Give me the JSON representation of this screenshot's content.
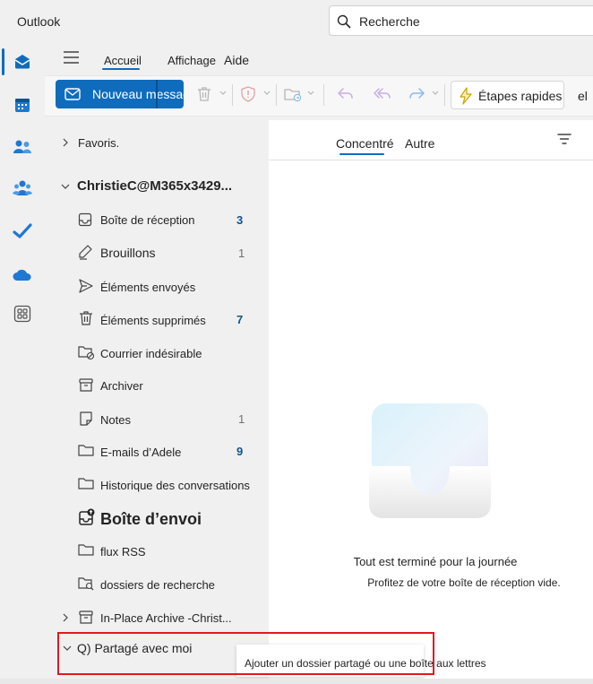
{
  "app": {
    "title": "Outlook"
  },
  "search": {
    "placeholder": "Recherche"
  },
  "rail": {
    "items": [
      {
        "icon": "mail-icon",
        "selected": true
      },
      {
        "icon": "calendar-icon"
      },
      {
        "icon": "people-icon"
      },
      {
        "icon": "groups-icon"
      },
      {
        "icon": "todo-check-icon"
      },
      {
        "icon": "onedrive-cloud-icon"
      },
      {
        "icon": "apps-grid-icon"
      }
    ],
    "accent": "#0f6cbd"
  },
  "ribbon": {
    "tabs": {
      "home": "Accueil",
      "view": "Affichage",
      "help": "Aide"
    },
    "new_message": "Nouveau message",
    "quick_steps": "Étapes rapides",
    "more_truncated": "el"
  },
  "folders": {
    "favorites": "Favoris.",
    "account": "ChristieC@M365x3429...",
    "items": [
      {
        "name": "Boîte de réception",
        "count": "3",
        "icon": "inbox-icon"
      },
      {
        "name": "Brouillons",
        "count": "1",
        "icon": "drafts-pencil-icon"
      },
      {
        "name": "Éléments envoyés",
        "count": "",
        "icon": "sent-icon"
      },
      {
        "name": "Éléments supprimés",
        "count": "7",
        "icon": "trash-icon"
      },
      {
        "name": "Courrier indésirable",
        "count": "",
        "icon": "junk-folder-icon"
      },
      {
        "name": "Archiver",
        "count": "",
        "icon": "archive-icon"
      },
      {
        "name": "Notes",
        "count": "1",
        "icon": "note-icon"
      },
      {
        "name": "E-mails d’Adele",
        "count": "9",
        "icon": "folder-icon"
      },
      {
        "name": "Historique des conversations",
        "count": "",
        "icon": "folder-icon"
      },
      {
        "name": "Boîte d’envoi",
        "count": "",
        "icon": "outbox-icon"
      },
      {
        "name": "flux RSS",
        "count": "",
        "icon": "folder-icon"
      },
      {
        "name": "dossiers de recherche",
        "count": "",
        "icon": "search-folder-icon"
      }
    ],
    "archive_group": "In-Place Archive -Christ...",
    "shared_with_me": "Q) Partagé avec moi"
  },
  "message_list": {
    "tab_focused": "Concentré",
    "tab_other": "Autre",
    "empty_title": "Tout est terminé pour la journée",
    "empty_subtitle": "Profitez de votre boîte de réception vide."
  },
  "tooltip": {
    "text": "Ajouter un dossier partagé ou une boîte aux lettres"
  },
  "colors": {
    "highlight": "#e0191e",
    "brand": "#0f6cbd"
  }
}
